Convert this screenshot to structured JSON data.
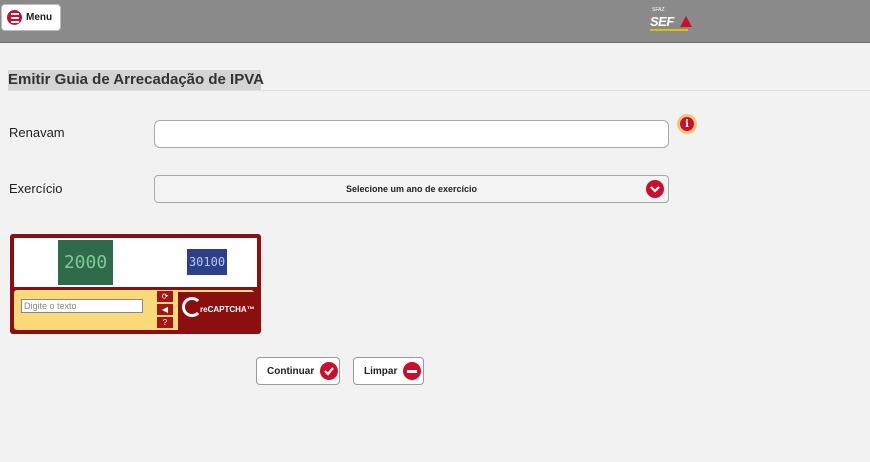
{
  "header": {
    "menu_label": "Menu",
    "logo_text": "SEF",
    "logo_small": "SFAZ"
  },
  "page": {
    "title": "Emitir Guia de Arrecadação de IPVA"
  },
  "form": {
    "renavam_label": "Renavam",
    "renavam_value": "",
    "exercicio_label": "Exercício",
    "exercicio_selected": "Selecione um ano de exercício"
  },
  "captcha": {
    "word1": "2000",
    "word2": "30100",
    "placeholder": "Digite o texto",
    "brand": "reCAPTCHA™"
  },
  "actions": {
    "continuar_label": "Continuar",
    "limpar_label": "Limpar"
  },
  "colors": {
    "accent": "#c8102e",
    "topbar": "#8a8a8a",
    "captcha_frame": "#8b0f0f"
  }
}
